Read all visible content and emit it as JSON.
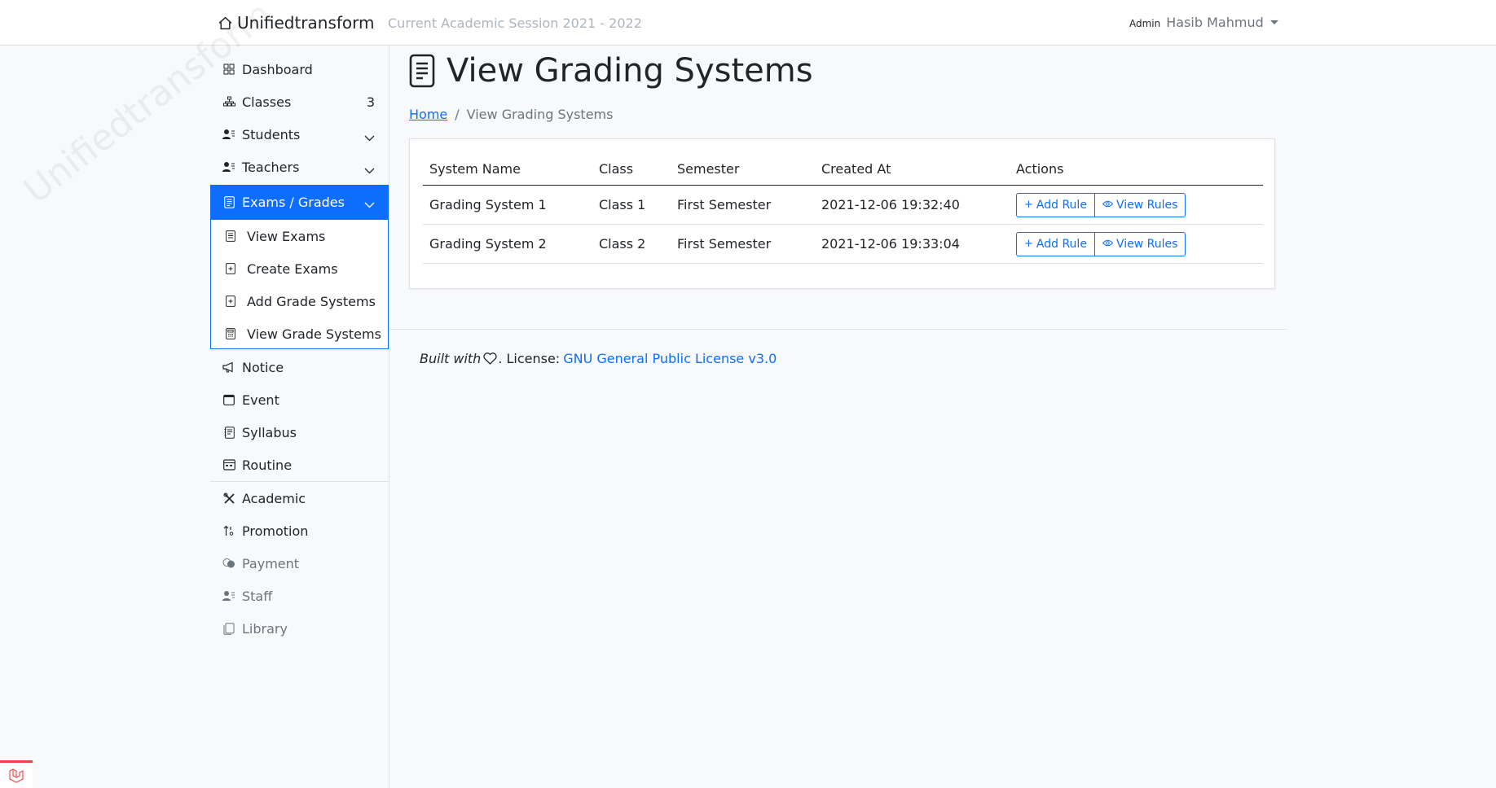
{
  "topbar": {
    "brand": "Unifiedtransform",
    "session": "Current Academic Session 2021 - 2022",
    "user_role": "Admin",
    "user_name": "Hasib Mahmud"
  },
  "sidebar": {
    "watermark": "Unifiedtransform",
    "items": [
      {
        "label": "Dashboard"
      },
      {
        "label": "Classes",
        "count": "3"
      },
      {
        "label": "Students"
      },
      {
        "label": "Teachers"
      },
      {
        "label": "Exams / Grades"
      },
      {
        "label": "Notice"
      },
      {
        "label": "Event"
      },
      {
        "label": "Syllabus"
      },
      {
        "label": "Routine"
      },
      {
        "label": "Academic"
      },
      {
        "label": "Promotion"
      },
      {
        "label": "Payment"
      },
      {
        "label": "Staff"
      },
      {
        "label": "Library"
      }
    ],
    "submenu": [
      {
        "label": "View Exams"
      },
      {
        "label": "Create Exams"
      },
      {
        "label": "Add Grade Systems"
      },
      {
        "label": "View Grade Systems"
      }
    ]
  },
  "main": {
    "title": "View Grading Systems",
    "breadcrumb": {
      "home": "Home",
      "current": "View Grading Systems"
    },
    "table": {
      "headers": [
        "System Name",
        "Class",
        "Semester",
        "Created At",
        "Actions"
      ],
      "rows": [
        {
          "name": "Grading System 1",
          "class": "Class 1",
          "semester": "First Semester",
          "created": "2021-12-06 19:32:40"
        },
        {
          "name": "Grading System 2",
          "class": "Class 2",
          "semester": "First Semester",
          "created": "2021-12-06 19:33:04"
        }
      ],
      "add_rule_label": "Add Rule",
      "view_rules_label": "View Rules"
    }
  },
  "footer": {
    "built_with": "Built with",
    "license_prefix": ". License:",
    "license_link": "GNU General Public License v3.0"
  },
  "colors": {
    "primary": "#0d6efd",
    "muted": "#6c757d",
    "laravel_red": "#ef4444"
  }
}
